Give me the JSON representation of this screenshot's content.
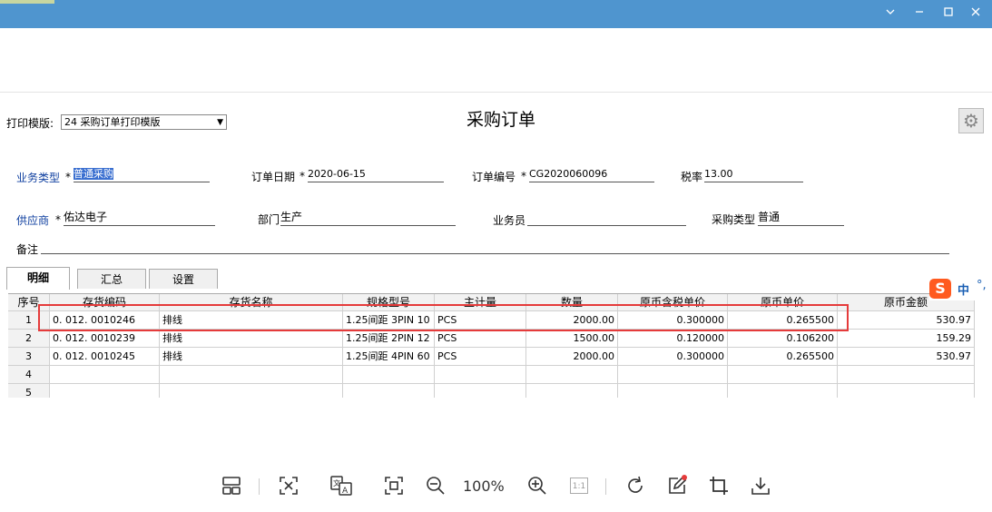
{
  "window": {
    "minimize_icon": "chevron-down-icon",
    "restore_icon": "minimize-icon",
    "maximize_icon": "maximize-icon",
    "close_icon": "close-icon"
  },
  "form": {
    "title": "采购订单",
    "template_label": "打印模版:",
    "template_value": "24 采购订单打印模版",
    "business_type_label": "业务类型",
    "business_type_value": "普通采购",
    "order_date_label": "订单日期",
    "order_date_value": "2020-06-15",
    "order_no_label": "订单编号",
    "order_no_value": "CG2020060096",
    "tax_rate_label": "税率",
    "tax_rate_value": "13.00",
    "supplier_label": "供应商",
    "supplier_value": "佑达电子",
    "department_label": "部门",
    "department_value": "生产",
    "salesperson_label": "业务员",
    "salesperson_value": "",
    "purchase_type_label": "采购类型",
    "purchase_type_value": "普通",
    "remark_label": "备注",
    "remark_value": "",
    "required_mark": "*"
  },
  "tabs": [
    "明细",
    "汇总",
    "设置"
  ],
  "table": {
    "headers": [
      "序号",
      "存货编码",
      "存货名称",
      "规格型号",
      "主计量",
      "数量",
      "原币含税单价",
      "原币单价",
      "原币金额"
    ],
    "rows": [
      [
        "1",
        "0. 012. 0010246",
        "排线",
        "1.25间距 3PIN 10",
        "PCS",
        "2000.00",
        "0.300000",
        "0.265500",
        "530.97"
      ],
      [
        "2",
        "0. 012. 0010239",
        "排线",
        "1.25间距 2PIN 12",
        "PCS",
        "1500.00",
        "0.120000",
        "0.106200",
        "159.29"
      ],
      [
        "3",
        "0. 012. 0010245",
        "排线",
        "1.25间距 4PIN 60",
        "PCS",
        "2000.00",
        "0.300000",
        "0.265500",
        "530.97"
      ],
      [
        "4",
        "",
        "",
        "",
        "",
        "",
        "",
        "",
        ""
      ],
      [
        "5",
        "",
        "",
        "",
        "",
        "",
        "",
        "",
        ""
      ]
    ]
  },
  "ime": {
    "logo": "S",
    "lang": "中",
    "punct": "°,"
  },
  "viewer_toolbar": {
    "zoom": "100%",
    "icons": [
      "layout-icon",
      "fit-screen-icon",
      "translate-icon",
      "crop-frame-icon",
      "zoom-out-icon",
      "zoom-in-icon",
      "actual-size-icon",
      "rotate-icon",
      "edit-icon",
      "crop-icon",
      "download-icon"
    ],
    "actual_size_label": "1:1"
  },
  "colors": {
    "titlebar": "#4f95cf",
    "highlight": "#e53b3b",
    "label_blue": "#1040a0"
  }
}
